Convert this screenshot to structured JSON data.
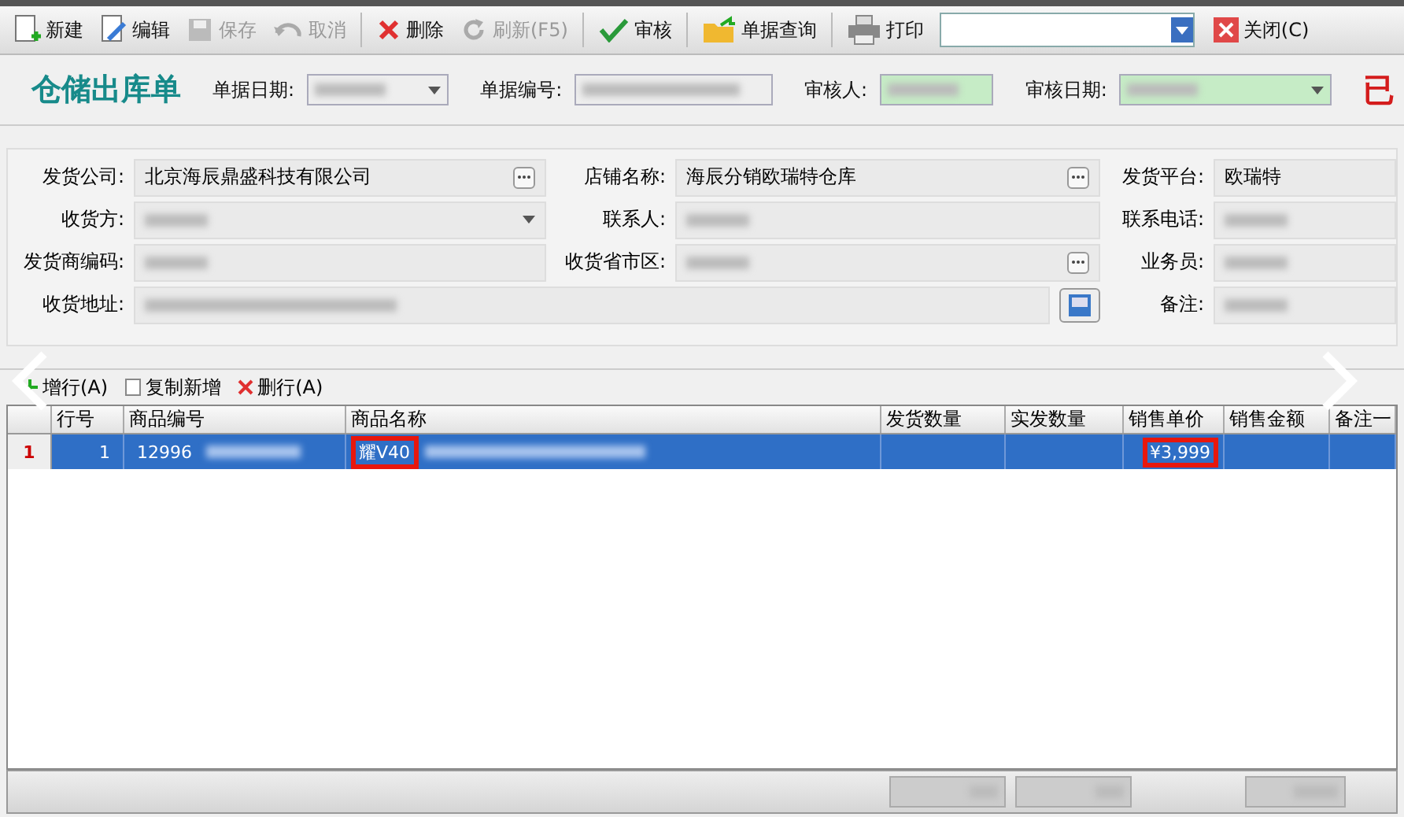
{
  "toolbar": [
    {
      "label": "新建",
      "disabled": false
    },
    {
      "label": "编辑",
      "disabled": false
    },
    {
      "label": "保存",
      "disabled": true
    },
    {
      "label": "取消",
      "disabled": true
    },
    {
      "label": "删除",
      "disabled": false
    },
    {
      "label": "刷新(F5)",
      "disabled": true
    },
    {
      "label": "审核",
      "disabled": false
    },
    {
      "label": "单据查询",
      "disabled": false
    },
    {
      "label": "打印",
      "disabled": false
    }
  ],
  "close_button": "关闭(C)",
  "header": {
    "title": "仓储出库单",
    "fields": [
      {
        "label": "单据日期:",
        "kind": "combo"
      },
      {
        "label": "单据编号:",
        "kind": "text"
      },
      {
        "label": "审核人:",
        "kind": "green"
      },
      {
        "label": "审核日期:",
        "kind": "greencombo"
      }
    ],
    "stamp": "已"
  },
  "form": [
    [
      {
        "label": "发货公司:",
        "value": "北京海辰鼎盛科技有限公司",
        "kind": "lookup"
      },
      {
        "label": "店铺名称:",
        "value": "海辰分销欧瑞特仓库",
        "kind": "lookup"
      },
      {
        "label": "发货平台:",
        "value": "欧瑞特",
        "kind": "text"
      }
    ],
    [
      {
        "label": "收货方:",
        "kind": "dropdown"
      },
      {
        "label": "联系人:",
        "kind": "text"
      },
      {
        "label": "联系电话:",
        "kind": "text"
      }
    ],
    [
      {
        "label": "发货商编码:",
        "kind": "text"
      },
      {
        "label": "收货省市区:",
        "kind": "lookup"
      },
      {
        "label": "业务员:",
        "kind": "text"
      }
    ],
    [
      {
        "label": "收货地址:",
        "kind": "address"
      },
      {
        "label": "备注:",
        "kind": "text"
      }
    ]
  ],
  "grid_actions": [
    "增行(A)",
    "复制新增",
    "删行(A)"
  ],
  "table": {
    "columns": [
      "行号",
      "商品编号",
      "商品名称",
      "发货数量",
      "实发数量",
      "销售单价",
      "销售金额",
      "备注一"
    ],
    "rows": [
      {
        "marker": "1",
        "selected": true,
        "cells": [
          {
            "text": "1",
            "highlighted": false
          },
          {
            "text": "12996",
            "highlighted": false
          },
          {
            "text": "耀V40",
            "highlighted": true
          },
          {
            "text": ""
          },
          {
            "text": ""
          },
          {
            "text": "¥3,999",
            "highlighted": true
          },
          {
            "text": ""
          },
          {
            "text": ""
          }
        ]
      }
    ]
  }
}
